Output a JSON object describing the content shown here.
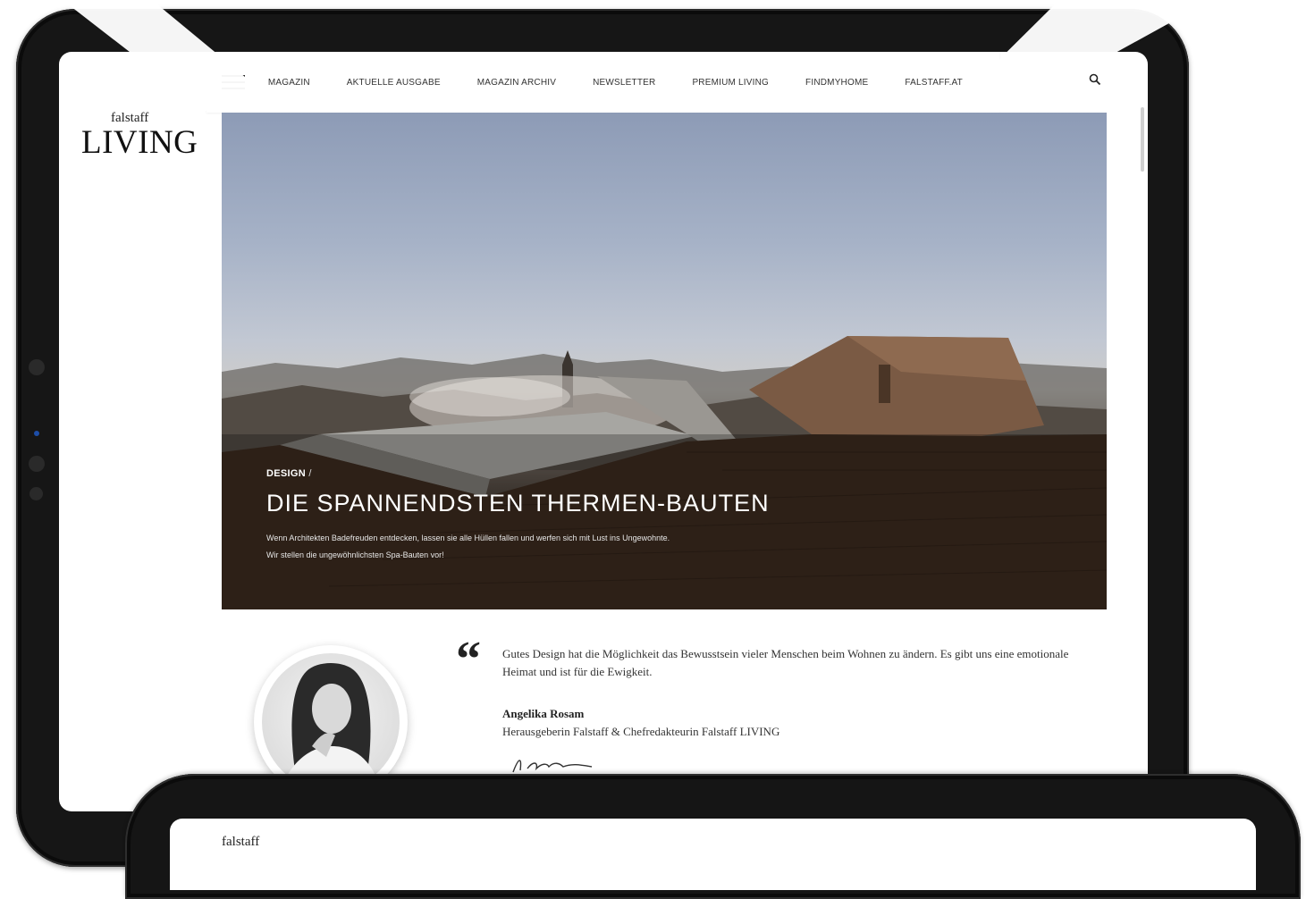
{
  "brand": {
    "small": "falstaff",
    "big": "LIVING",
    "front_small": "falstaff"
  },
  "nav": {
    "items": [
      "MAGAZIN",
      "AKTUELLE AUSGABE",
      "MAGAZIN ARCHIV",
      "NEWSLETTER",
      "PREMIUM LIVING",
      "FINDMYHOME",
      "FALSTAFF.AT"
    ]
  },
  "hero": {
    "category": "DESIGN",
    "separator": "/",
    "title": "DIE SPANNENDSTEN THERMEN-BAUTEN",
    "description_line1": "Wenn Architekten Badefreuden entdecken, lassen sie alle Hüllen fallen und werfen sich mit Lust ins Ungewohnte.",
    "description_line2": "Wir stellen die ungewöhnlichsten Spa-Bauten vor!"
  },
  "quote": {
    "mark": "“",
    "text": "Gutes Design hat die Möglichkeit das Bewusstsein vieler Menschen beim Wohnen zu ändern. Es gibt uns eine emotionale Heimat und ist für die Ewigkeit.",
    "name": "Angelika Rosam",
    "role": "Herausgeberin Falstaff & Chefredakteurin Falstaff LIVING"
  },
  "icons": [
    "hamburger-menu-icon",
    "search-icon"
  ],
  "colors": {
    "device_frame": "#161616",
    "screen_bg": "#ffffff",
    "text_dark": "#222222"
  }
}
